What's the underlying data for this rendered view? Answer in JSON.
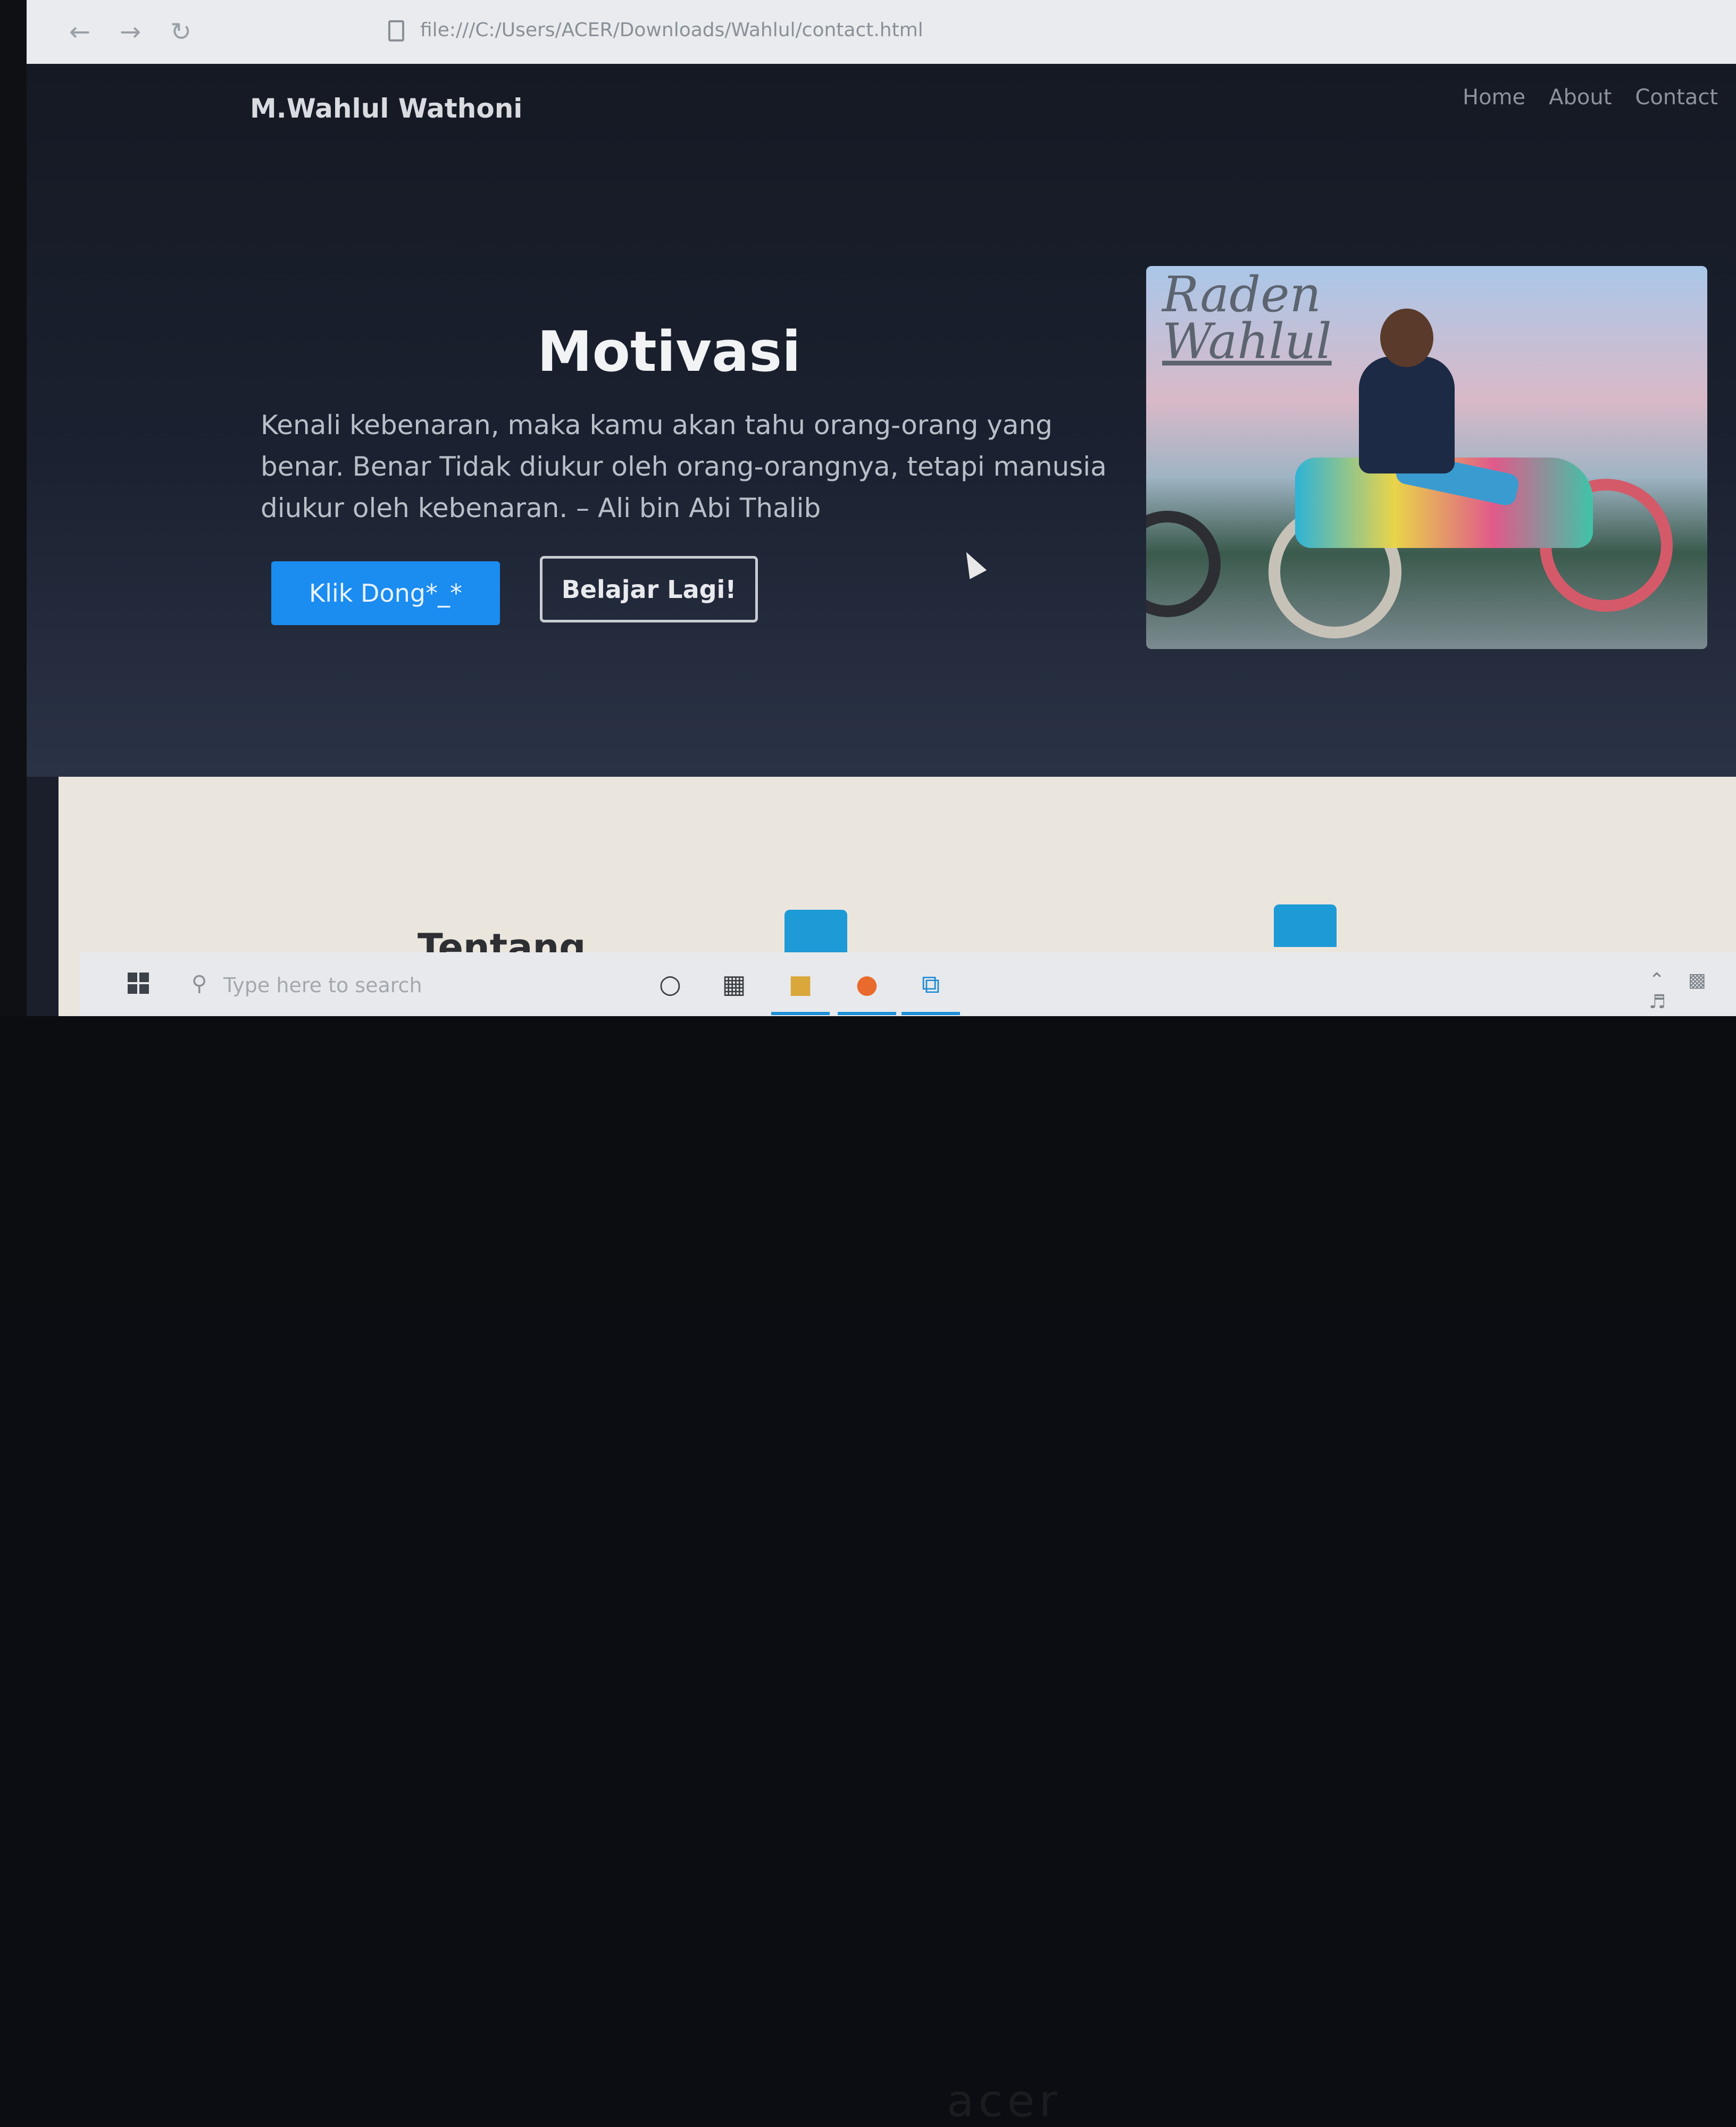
{
  "browser": {
    "back_icon": "arrow-left-icon",
    "forward_icon": "arrow-right-icon",
    "reload_icon": "reload-icon",
    "url": "file:///C:/Users/ACER/Downloads/Wahlul/contact.html",
    "bookmark_icon": "star-icon"
  },
  "site": {
    "brand": "M.Wahlul Wathoni",
    "nav": [
      "Home",
      "About",
      "Contact"
    ]
  },
  "hero": {
    "title": "Motivasi",
    "quote": "Kenali kebenaran, maka kamu akan tahu orang-orang yang benar. Benar Tidak diukur oleh orang-orangnya, tetapi manusia diukur oleh kebenaran. – Ali bin Abi Thalib",
    "primary_button": "Klik Dong*_*",
    "secondary_button": "Belajar Lagi!",
    "photo_caption_line1": "Raden",
    "photo_caption_line2": "Wahlul",
    "primary_color": "#1b8cf0"
  },
  "section": {
    "title": "Tentang"
  },
  "taskbar": {
    "search_placeholder": "Type here to search",
    "apps": [
      "windows-start-icon",
      "cortana-icon",
      "task-view-icon",
      "file-explorer-icon",
      "firefox-icon",
      "vscode-icon"
    ]
  },
  "device": {
    "logo": "acer"
  }
}
